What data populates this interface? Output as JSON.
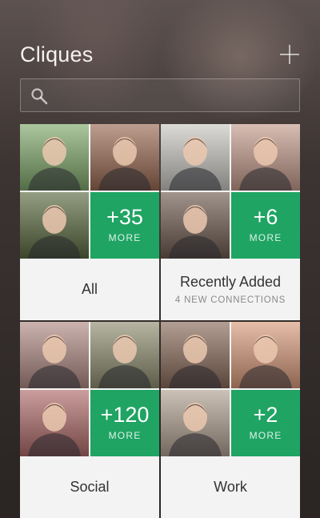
{
  "header": {
    "title": "Cliques",
    "add_icon": "plus-icon"
  },
  "search": {
    "placeholder": "",
    "value": "",
    "icon": "search-icon"
  },
  "cliques": [
    {
      "name": "All",
      "subtitle": "",
      "more_count": "+35",
      "more_label": "MORE",
      "photo_colors": [
        "#7fa86a",
        "#9a6a52",
        "#5a6a40"
      ]
    },
    {
      "name": "Recently Added",
      "subtitle": "4 NEW CONNECTIONS",
      "more_count": "+6",
      "more_label": "MORE",
      "photo_colors": [
        "#c9c7c2",
        "#c29a8a",
        "#6e5a4e"
      ]
    },
    {
      "name": "Social",
      "subtitle": "",
      "more_count": "+120",
      "more_label": "MORE",
      "photo_colors": [
        "#b08a84",
        "#8e8e70",
        "#b06a6a"
      ]
    },
    {
      "name": "Work",
      "subtitle": "",
      "more_count": "+2",
      "more_label": "MORE",
      "photo_colors": [
        "#8a6a5a",
        "#d99a7a",
        "#b0a090"
      ]
    }
  ],
  "colors": {
    "accent": "#1fa463",
    "card_bg": "#f3f3f3"
  }
}
